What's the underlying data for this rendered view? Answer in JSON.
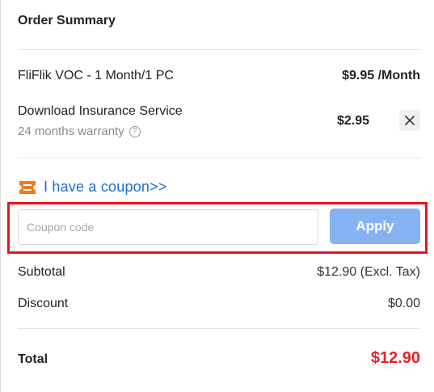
{
  "summary": {
    "title": "Order Summary",
    "product": {
      "name": "FliFlik VOC - 1 Month/1 PC",
      "price": "$9.95 /Month"
    },
    "insurance": {
      "name": "Download Insurance Service",
      "subtitle": "24 months warranty",
      "price": "$2.95"
    },
    "coupon": {
      "link_text": "I have a coupon>>",
      "placeholder": "Coupon code",
      "value": "",
      "apply_label": "Apply"
    },
    "subtotal": {
      "label": "Subtotal",
      "value": "$12.90 (Excl. Tax)"
    },
    "discount": {
      "label": "Discount",
      "value": "$0.00"
    },
    "total": {
      "label": "Total",
      "value": "$12.90"
    }
  },
  "colors": {
    "accent": "#1a6fd6",
    "apply_bg": "#87b2f1",
    "total": "#e1232b",
    "coupon_icon": "#f07a1e",
    "highlight": "#e8151b"
  },
  "icons": {
    "help": "question-circle-icon",
    "remove": "close-icon",
    "coupon": "ticket-icon"
  }
}
